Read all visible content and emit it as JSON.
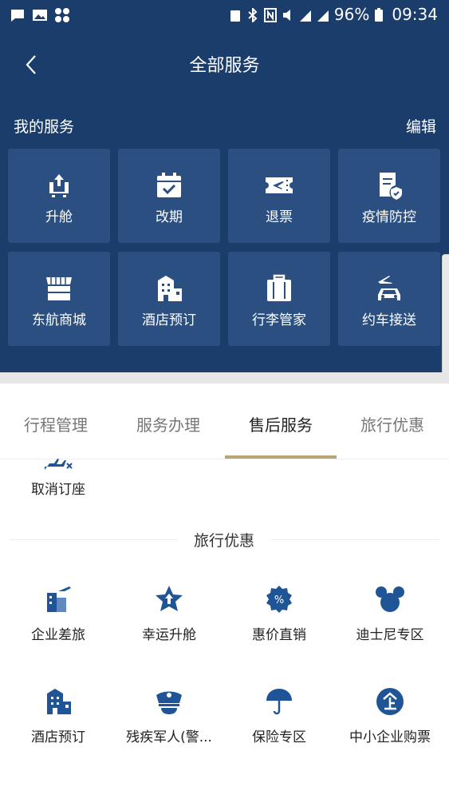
{
  "status_bar": {
    "battery": "96%",
    "time": "09:34",
    "network": "4G"
  },
  "header": {
    "title": "全部服务",
    "my_services_label": "我的服务",
    "edit_label": "编辑"
  },
  "my_services": [
    {
      "label": "升舱",
      "icon": "seat-upgrade-icon"
    },
    {
      "label": "改期",
      "icon": "calendar-check-icon"
    },
    {
      "label": "退票",
      "icon": "ticket-refund-icon"
    },
    {
      "label": "疫情防控",
      "icon": "epidemic-shield-icon"
    },
    {
      "label": "东航商城",
      "icon": "shop-icon"
    },
    {
      "label": "酒店预订",
      "icon": "hotel-icon"
    },
    {
      "label": "行李管家",
      "icon": "luggage-icon"
    },
    {
      "label": "约车接送",
      "icon": "car-pickup-icon"
    }
  ],
  "tabs": [
    {
      "label": "行程管理",
      "active": false
    },
    {
      "label": "服务办理",
      "active": false
    },
    {
      "label": "售后服务",
      "active": true
    },
    {
      "label": "旅行优惠",
      "active": false
    }
  ],
  "after_sales": {
    "cancel_label": "取消订座",
    "icon": "cancel-booking-icon"
  },
  "travel_deals": {
    "title": "旅行优惠",
    "items": [
      {
        "label": "企业差旅",
        "icon": "business-travel-icon"
      },
      {
        "label": "幸运升舱",
        "icon": "lucky-upgrade-icon"
      },
      {
        "label": "惠价直销",
        "icon": "discount-icon"
      },
      {
        "label": "迪士尼专区",
        "icon": "disney-icon"
      },
      {
        "label": "酒店预订",
        "icon": "hotel-icon"
      },
      {
        "label": "残疾军人(警...",
        "icon": "police-cap-icon"
      },
      {
        "label": "保险专区",
        "icon": "umbrella-icon"
      },
      {
        "label": "中小企业购票",
        "icon": "enterprise-icon"
      }
    ]
  },
  "colors": {
    "header_bg": "#1b3d6b",
    "tile_bg": "#2a4f80",
    "tab_indicator": "#b9a473",
    "icon_blue": "#1f5596"
  }
}
